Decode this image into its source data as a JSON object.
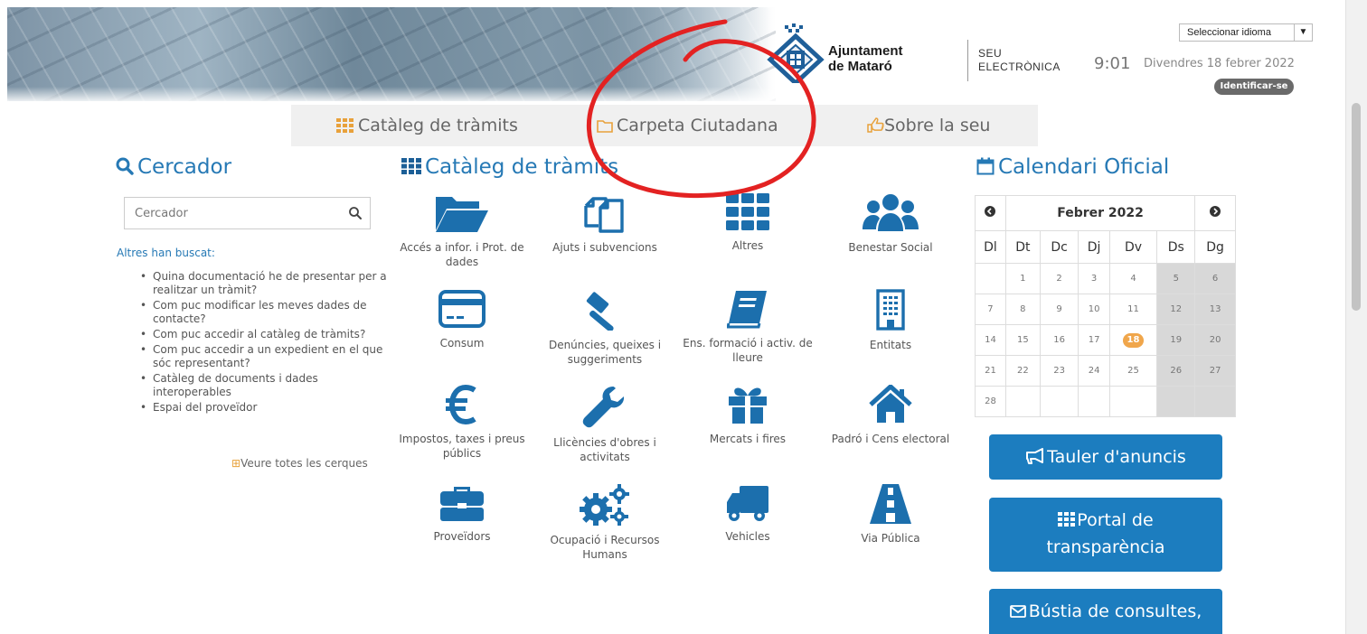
{
  "header": {
    "org_line1": "Ajuntament",
    "org_line2": "de Mataró",
    "seu_line1": "SEU",
    "seu_line2": "ELECTRÒNICA",
    "time": "9:01",
    "date": "Divendres 18 febrer 2022",
    "language_select": "Seleccionar idioma",
    "login_label": "Identificar-se"
  },
  "nav": {
    "items": [
      {
        "label": "Catàleg de tràmits",
        "icon": "grid-icon"
      },
      {
        "label": "Carpeta Ciutadana",
        "icon": "folder-icon"
      },
      {
        "label": "Sobre la seu",
        "icon": "hand-pointer-icon"
      }
    ]
  },
  "search": {
    "title": "Cercador",
    "placeholder": "Cercador",
    "others_title": "Altres han buscat:",
    "items": [
      "Quina documentació he de presentar per a realitzar un tràmit?",
      "Com puc modificar les meves dades de contacte?",
      "Com puc accedir al catàleg de tràmits?",
      "Com puc accedir a un expedient en el que sóc representant?",
      "Catàleg de documents i dades interoperables",
      "Espai del proveïdor"
    ],
    "see_all": "Veure totes les cerques"
  },
  "catalog": {
    "title": "Catàleg de tràmits",
    "tiles": [
      {
        "label": "Accés a infor. i Prot. de dades",
        "icon": "folder-open-icon"
      },
      {
        "label": "Ajuts i subvencions",
        "icon": "copy-documents-icon"
      },
      {
        "label": "Altres",
        "icon": "grid-icon"
      },
      {
        "label": "Benestar Social",
        "icon": "users-icon"
      },
      {
        "label": "Consum",
        "icon": "credit-card-icon"
      },
      {
        "label": "Denúncies, queixes i suggeriments",
        "icon": "gavel-icon"
      },
      {
        "label": "Ens. formació i activ. de lleure",
        "icon": "book-icon"
      },
      {
        "label": "Entitats",
        "icon": "building-icon"
      },
      {
        "label": "Impostos, taxes i preus públics",
        "icon": "euro-icon"
      },
      {
        "label": "Llicències d'obres i activitats",
        "icon": "wrench-icon"
      },
      {
        "label": "Mercats i fires",
        "icon": "gift-icon"
      },
      {
        "label": "Padró i Cens electoral",
        "icon": "home-icon"
      },
      {
        "label": "Proveïdors",
        "icon": "briefcase-icon"
      },
      {
        "label": "Ocupació i Recursos Humans",
        "icon": "cogs-icon"
      },
      {
        "label": "Vehicles",
        "icon": "truck-icon"
      },
      {
        "label": "Via Pública",
        "icon": "road-icon"
      }
    ]
  },
  "calendar": {
    "title": "Calendari Oficial",
    "month": "Febrer 2022",
    "days_of_week": [
      "Dl",
      "Dt",
      "Dc",
      "Dj",
      "Dv",
      "Ds",
      "Dg"
    ],
    "weeks": [
      [
        "",
        "1",
        "2",
        "3",
        "4",
        "5",
        "6"
      ],
      [
        "7",
        "8",
        "9",
        "10",
        "11",
        "12",
        "13"
      ],
      [
        "14",
        "15",
        "16",
        "17",
        "18",
        "19",
        "20"
      ],
      [
        "21",
        "22",
        "23",
        "24",
        "25",
        "26",
        "27"
      ],
      [
        "28",
        "",
        "",
        "",
        "",
        "",
        ""
      ]
    ],
    "today": "18"
  },
  "side_buttons": {
    "tauler": "Tauler d'anuncis",
    "portal_line1": "Portal de",
    "portal_line2": "transparència",
    "bustia": "Bústia de consultes,"
  },
  "colors": {
    "accent_blue": "#2679b5",
    "button_blue": "#1c7dbf",
    "today_orange": "#f0a64b",
    "annotation_red": "#e32222"
  }
}
